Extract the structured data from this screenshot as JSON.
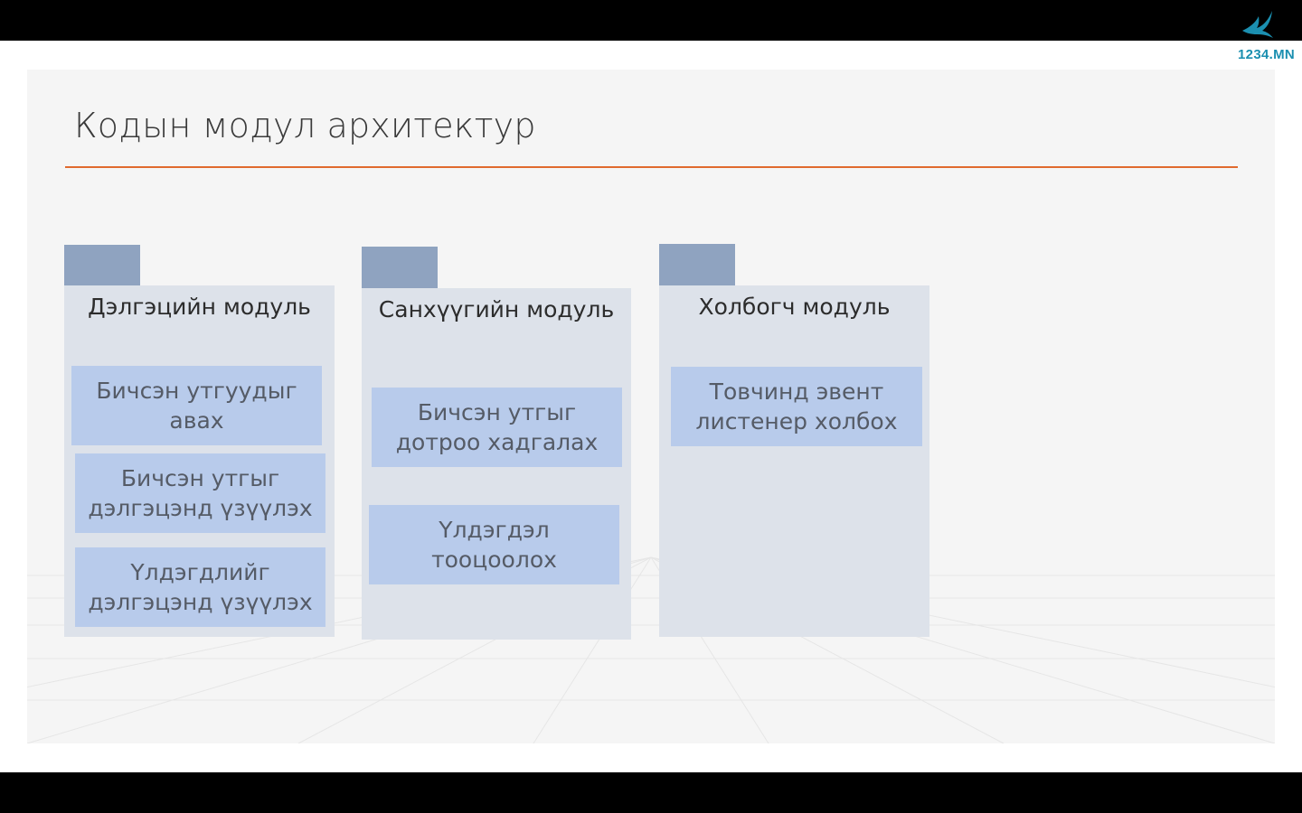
{
  "brand": {
    "logo_icon": "bird-icon",
    "logo_text": "1234.MN"
  },
  "colors": {
    "logo": "#1b8fb0",
    "accent_rule": "#e06a2e",
    "module_tab": "#8fa3c0",
    "module_body": "#dde2ea",
    "item_box": "#b8cbeb",
    "letterbox": "#000000",
    "slide_background": "#f5f5f5"
  },
  "slide": {
    "title": "Кодын модул архитектур",
    "modules": [
      {
        "title": "Дэлгэцийн модуль",
        "items": [
          [
            "Бичсэн утгуудыг",
            "авах"
          ],
          [
            "Бичсэн утгыг",
            "дэлгэцэнд үзүүлэх"
          ],
          [
            "Үлдэгдлийг",
            "дэлгэцэнд үзүүлэх"
          ]
        ]
      },
      {
        "title": "Санхүүгийн модуль",
        "items": [
          [
            "Бичсэн утгыг",
            "дотроо хадгалах"
          ],
          [
            "Үлдэгдэл",
            "тооцоолох"
          ]
        ]
      },
      {
        "title": "Холбогч модуль",
        "items": [
          [
            "Товчинд эвент",
            "листенер холбох"
          ]
        ]
      }
    ]
  }
}
